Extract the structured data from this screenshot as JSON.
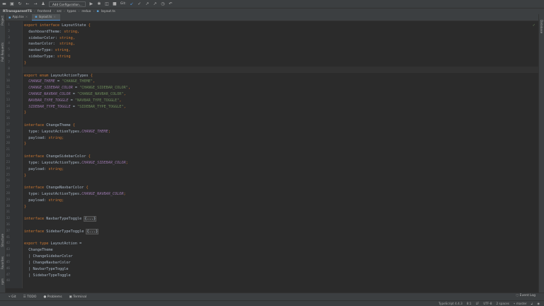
{
  "toolbar": {
    "add_config": "Add Configuration...",
    "git_label": "Git:"
  },
  "breadcrumb": [
    "RTransparentTS",
    "frontend",
    "src",
    "types",
    "redux",
    "layout.ts"
  ],
  "tabs": [
    {
      "label": "App.tsx",
      "close": "×"
    },
    {
      "label": "layout.ts",
      "close": "×"
    }
  ],
  "left_tools": [
    "Project",
    "Pull Requests",
    "Structure",
    "Favorites",
    "npm"
  ],
  "right_tools": [
    "Database"
  ],
  "code": [
    {
      "n": "1",
      "t": [
        [
          "export interface ",
          "kw"
        ],
        [
          "LayoutState ",
          "id"
        ],
        [
          "{",
          "pun"
        ]
      ]
    },
    {
      "n": "2",
      "t": [
        [
          "  dashboardTheme: ",
          "id"
        ],
        [
          "string",
          "kw"
        ],
        [
          ",",
          "pun"
        ]
      ]
    },
    {
      "n": "3",
      "t": [
        [
          "  sidebarColor: ",
          "id"
        ],
        [
          "string",
          "kw"
        ],
        [
          ",",
          "pun"
        ]
      ]
    },
    {
      "n": "4",
      "t": [
        [
          "  navbarColor:  ",
          "id"
        ],
        [
          "string",
          "kw"
        ],
        [
          ",",
          "pun"
        ]
      ]
    },
    {
      "n": "5",
      "t": [
        [
          "  navbarType: ",
          "id"
        ],
        [
          "string",
          "kw"
        ],
        [
          ",",
          "pun"
        ]
      ]
    },
    {
      "n": "6",
      "t": [
        [
          "  sidebarType: ",
          "id"
        ],
        [
          "string",
          "kw"
        ]
      ]
    },
    {
      "n": "7",
      "t": [
        [
          "}",
          "pun"
        ]
      ]
    },
    {
      "n": "8",
      "t": [],
      "cur": true
    },
    {
      "n": "9",
      "t": [
        [
          "export enum ",
          "kw"
        ],
        [
          "LayoutActionTypes ",
          "id"
        ],
        [
          "{",
          "pun"
        ]
      ]
    },
    {
      "n": "10",
      "t": [
        [
          "  CHANGE_THEME",
          "con"
        ],
        [
          " = ",
          "id"
        ],
        [
          "\"CHANGE_THEME\"",
          "str"
        ],
        [
          ",",
          "pun"
        ]
      ]
    },
    {
      "n": "11",
      "t": [
        [
          "  CHANGE_SIDEBAR_COLOR",
          "con"
        ],
        [
          " = ",
          "id"
        ],
        [
          "\"CHANGE_SIDEBAR_COLOR\"",
          "str"
        ],
        [
          ",",
          "pun"
        ]
      ]
    },
    {
      "n": "12",
      "t": [
        [
          "  CHANGE_NAVBAR_COLOR",
          "con"
        ],
        [
          " = ",
          "id"
        ],
        [
          "\"CHANGE_NAVBAR_COLOR\"",
          "str"
        ],
        [
          ",",
          "pun"
        ]
      ]
    },
    {
      "n": "13",
      "t": [
        [
          "  NAVBAR_TYPE_TOGGLE",
          "con"
        ],
        [
          " = ",
          "id"
        ],
        [
          "\"NAVBAR_TYPE_TOGGLE\"",
          "str"
        ],
        [
          ",",
          "pun"
        ]
      ]
    },
    {
      "n": "14",
      "t": [
        [
          "  SIDEBAR_TYPE_TOGGLE",
          "con"
        ],
        [
          " = ",
          "id"
        ],
        [
          "\"SIDEBAR_TYPE_TOGGLE\"",
          "str"
        ],
        [
          ",",
          "pun"
        ]
      ]
    },
    {
      "n": "15",
      "t": [
        [
          "}",
          "pun"
        ]
      ]
    },
    {
      "n": "16",
      "t": []
    },
    {
      "n": "17",
      "t": [
        [
          "interface ",
          "kw"
        ],
        [
          "ChangeTheme ",
          "id"
        ],
        [
          "{",
          "pun"
        ]
      ]
    },
    {
      "n": "18",
      "t": [
        [
          "  type: LayoutActionTypes.",
          "id"
        ],
        [
          "CHANGE_THEME",
          "con"
        ],
        [
          ";",
          "pun"
        ]
      ]
    },
    {
      "n": "19",
      "t": [
        [
          "  payload: ",
          "id"
        ],
        [
          "string",
          "kw"
        ],
        [
          ";",
          "pun"
        ]
      ]
    },
    {
      "n": "20",
      "t": [
        [
          "}",
          "pun"
        ]
      ]
    },
    {
      "n": "21",
      "t": []
    },
    {
      "n": "22",
      "t": [
        [
          "interface ",
          "kw"
        ],
        [
          "ChangeSidebarColor ",
          "id"
        ],
        [
          "{",
          "pun"
        ]
      ]
    },
    {
      "n": "23",
      "t": [
        [
          "  type: LayoutActionTypes.",
          "id"
        ],
        [
          "CHANGE_SIDEBAR_COLOR",
          "con"
        ],
        [
          ";",
          "pun"
        ]
      ]
    },
    {
      "n": "24",
      "t": [
        [
          "  payload: ",
          "id"
        ],
        [
          "string",
          "kw"
        ],
        [
          ";",
          "pun"
        ]
      ]
    },
    {
      "n": "25",
      "t": [
        [
          "}",
          "pun"
        ]
      ]
    },
    {
      "n": "26",
      "t": []
    },
    {
      "n": "27",
      "t": [
        [
          "interface ",
          "kw"
        ],
        [
          "ChangeNavbarColor ",
          "id"
        ],
        [
          "{",
          "pun"
        ]
      ]
    },
    {
      "n": "28",
      "t": [
        [
          "  type: LayoutActionTypes.",
          "id"
        ],
        [
          "CHANGE_NAVBAR_COLOR",
          "con"
        ],
        [
          ";",
          "pun"
        ]
      ]
    },
    {
      "n": "29",
      "t": [
        [
          "  payload: ",
          "id"
        ],
        [
          "string",
          "kw"
        ],
        [
          ";",
          "pun"
        ]
      ]
    },
    {
      "n": "30",
      "t": [
        [
          "}",
          "pun"
        ]
      ]
    },
    {
      "n": "31",
      "t": []
    },
    {
      "n": "32",
      "t": [
        [
          "interface ",
          "kw"
        ],
        [
          "NavbarTypeToggle ",
          "id"
        ],
        [
          "{...}",
          "fold"
        ]
      ]
    },
    {
      "n": "36",
      "t": []
    },
    {
      "n": "37",
      "t": [
        [
          "interface ",
          "kw"
        ],
        [
          "SidebarTypeToggle ",
          "id"
        ],
        [
          "{...}",
          "fold"
        ]
      ]
    },
    {
      "n": "41",
      "t": []
    },
    {
      "n": "42",
      "t": [
        [
          "export type ",
          "kw"
        ],
        [
          "LayoutAction =",
          "id"
        ]
      ]
    },
    {
      "n": "43",
      "t": [
        [
          "  ChangeTheme",
          "id"
        ]
      ]
    },
    {
      "n": "44",
      "t": [
        [
          "  | ChangeSidebarColor",
          "id"
        ]
      ]
    },
    {
      "n": "45",
      "t": [
        [
          "  | ChangeNavbarColor",
          "id"
        ]
      ]
    },
    {
      "n": "46",
      "t": [
        [
          "  | NavbarTypeToggle",
          "id"
        ]
      ]
    },
    {
      "n": "47",
      "t": [
        [
          "  | SidebarTypeToggle",
          "id"
        ]
      ]
    },
    {
      "n": "48",
      "t": []
    }
  ],
  "bottom_tools": [
    "Git",
    "TODO",
    "Problems",
    "Terminal"
  ],
  "event_log": "Event Log",
  "status": [
    "TypeScript 4.4.3",
    "8:1",
    "LF",
    "UTF-8",
    "2 spaces",
    "master"
  ]
}
